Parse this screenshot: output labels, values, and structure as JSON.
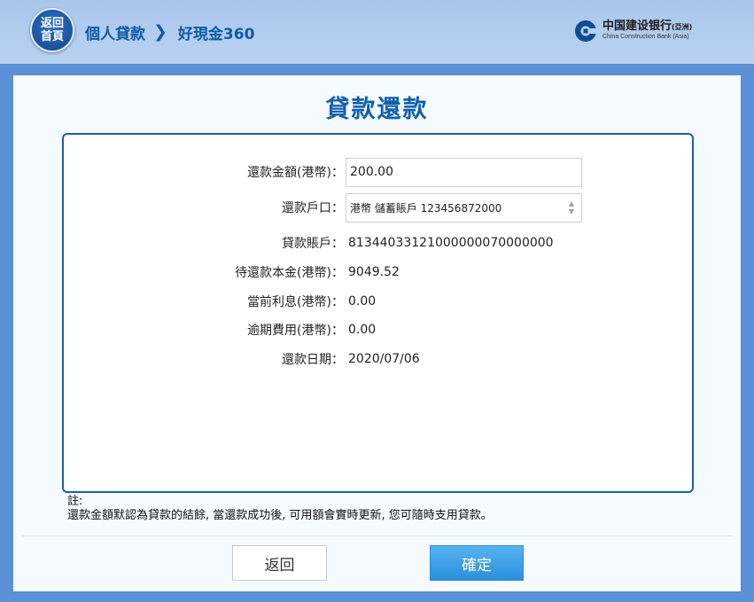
{
  "header": {
    "home_button": [
      "返回",
      "首頁"
    ],
    "breadcrumb": [
      "個人貸款",
      "好現金360"
    ],
    "breadcrumb_separator": "❯",
    "brand_cn": "中国建设银行",
    "brand_cn_suffix": "(亞洲)",
    "brand_en": "China Construction Bank (Asia)",
    "brand_color": "#0f4c9a"
  },
  "page": {
    "title": "貸款還款"
  },
  "form": {
    "amount_label": "還款金額(港幣)：",
    "amount_value": "200.00",
    "account_label": "還款戶口：",
    "account_value": "港幣 儲蓄賬戶 123456872000",
    "fields": [
      {
        "label": "貸款賬戶：",
        "value": "8134403312100000007000000​0"
      },
      {
        "label": "待還款本金(港幣)：",
        "value": "9049.52"
      },
      {
        "label": "當前利息(港幣)：",
        "value": "0.00"
      },
      {
        "label": "逾期費用(港幣)：",
        "value": "0.00"
      },
      {
        "label": "還款日期：",
        "value": "2020/07/06"
      }
    ]
  },
  "note": {
    "title": "註:",
    "text": "還款金額默認為貸款的結餘, 當還款成功後, 可用額會實時更新, 您可隨時支用貸款。"
  },
  "buttons": {
    "back": "返回",
    "confirm": "確定"
  },
  "colors": {
    "accent": "#1160ae",
    "confirm_button": "#3a9be5",
    "page_background": "#5b8fd6"
  }
}
